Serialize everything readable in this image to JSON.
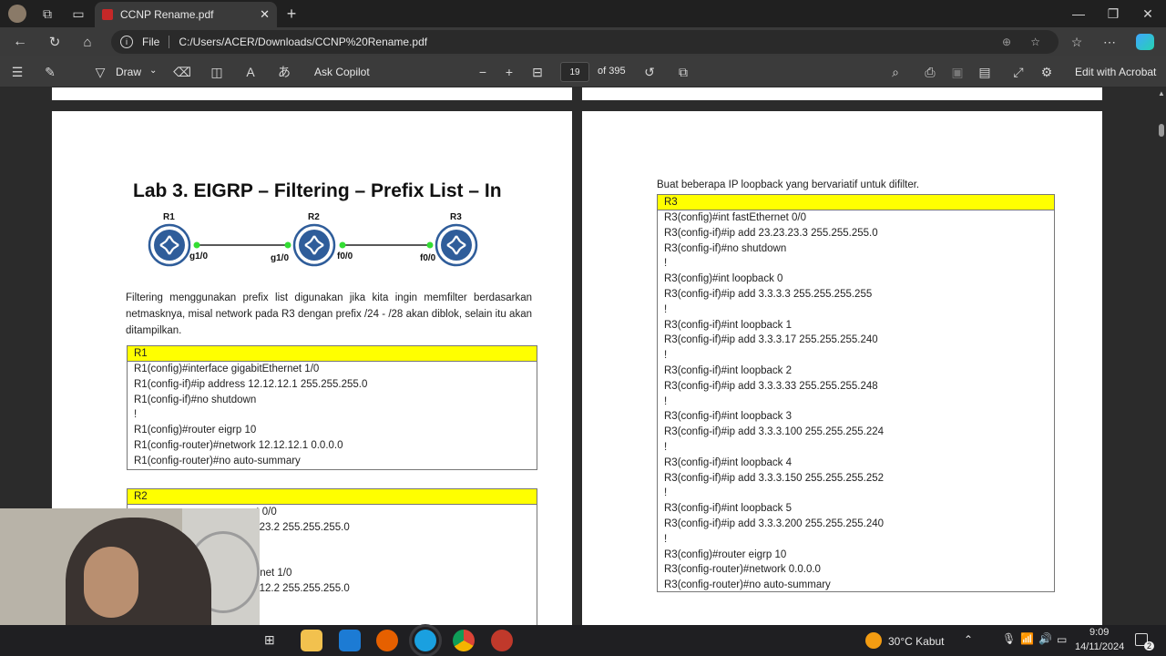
{
  "browser": {
    "tab_title": "CCNP Rename.pdf",
    "url_scheme": "File",
    "url_path": "C:/Users/ACER/Downloads/CCNP%20Rename.pdf"
  },
  "pdf_toolbar": {
    "draw_label": "Draw",
    "ask_copilot_label": "Ask Copilot",
    "page_number": "19",
    "page_total": "of 395",
    "edit_acrobat_label": "Edit with Acrobat"
  },
  "page_left": {
    "heading": "Lab 3. EIGRP – Filtering – Prefix List – In",
    "topology": {
      "routers": [
        "R1",
        "R2",
        "R3"
      ],
      "interfaces": [
        "g1/0",
        "g1/0",
        "f0/0",
        "f0/0"
      ]
    },
    "paragraph": "Filtering menggunakan prefix list digunakan jika kita ingin memfilter berdasarkan netmasknya, misal network pada R3 dengan prefix /24 - /28 akan diblok, selain itu akan ditampilkan.",
    "r1": {
      "header": "R1",
      "lines": [
        "R1(config)#interface gigabitEthernet 1/0",
        "R1(config-if)#ip address 12.12.12.1 255.255.255.0",
        "R1(config-if)#no shutdown",
        "!",
        "R1(config)#router eigrp 10",
        "R1(config-router)#network 12.12.12.1 0.0.0.0",
        "R1(config-router)#no auto-summary"
      ]
    },
    "r2": {
      "header": "R2",
      "lines": [
        "et 0/0",
        "3.23.2 255.255.255.0",
        "n",
        "",
        "ernet 1/0",
        "2.12.2 255.255.255.0",
        "n"
      ]
    }
  },
  "page_right": {
    "intro": "Buat beberapa IP loopback yang bervariatif untuk difilter.",
    "r3": {
      "header": "R3",
      "lines": [
        "R3(config)#int fastEthernet 0/0",
        "R3(config-if)#ip add 23.23.23.3 255.255.255.0",
        "R3(config-if)#no shutdown",
        "!",
        "R3(config)#int loopback 0",
        "R3(config-if)#ip add 3.3.3.3 255.255.255.255",
        "!",
        "R3(config-if)#int loopback 1",
        "R3(config-if)#ip add 3.3.3.17 255.255.255.240",
        "!",
        "R3(config-if)#int loopback 2",
        "R3(config-if)#ip add 3.3.3.33 255.255.255.248",
        "!",
        "R3(config-if)#int loopback 3",
        "R3(config-if)#ip add 3.3.3.100 255.255.255.224",
        "!",
        "R3(config-if)#int loopback 4",
        "R3(config-if)#ip add 3.3.3.150 255.255.255.252",
        "!",
        "R3(config-if)#int loopback 5",
        "R3(config-if)#ip add 3.3.3.200 255.255.255.240",
        "!",
        "R3(config)#router eigrp 10",
        "R3(config-router)#network 0.0.0.0",
        "R3(config-router)#no auto-summary"
      ]
    }
  },
  "taskbar": {
    "weather": "30°C  Kabut",
    "time": "9:09",
    "date": "14/11/2024",
    "notification_count": "2"
  },
  "colors": {
    "code_header": "#ffff00",
    "router_blue": "#2f5d9a",
    "link_green": "#33dd33"
  }
}
